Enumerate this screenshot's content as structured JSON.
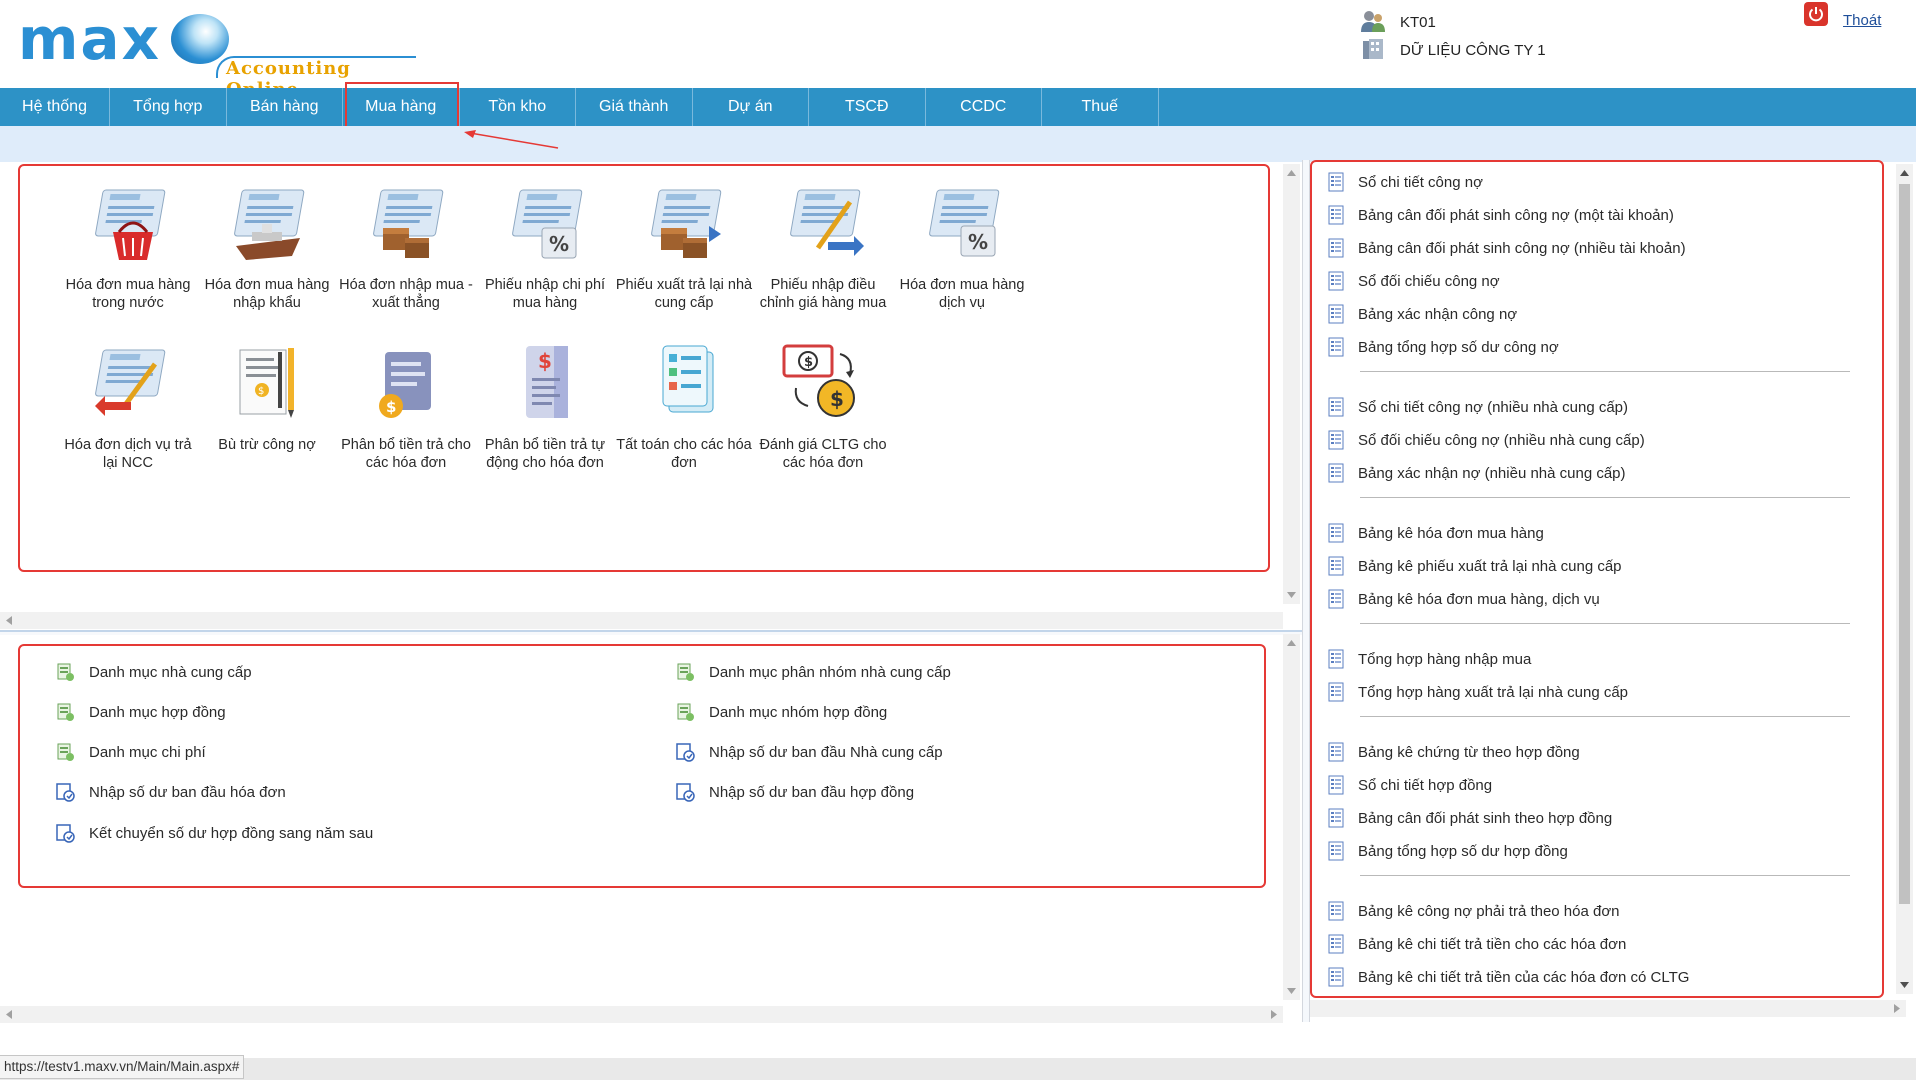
{
  "brand": {
    "logo_text": "maxv",
    "tagline": "Accounting Online"
  },
  "user": {
    "name": "KT01",
    "company": "DỮ LIỆU CÔNG TY 1",
    "logout_label": "Thoát"
  },
  "nav": {
    "items": [
      {
        "label": "Hệ thống"
      },
      {
        "label": "Tổng hợp"
      },
      {
        "label": "Bán hàng"
      },
      {
        "label": "Mua hàng"
      },
      {
        "label": "Tồn kho"
      },
      {
        "label": "Giá thành"
      },
      {
        "label": "Dự án"
      },
      {
        "label": "TSCĐ"
      },
      {
        "label": "CCDC"
      },
      {
        "label": "Thuế"
      }
    ],
    "active": "Mua hàng"
  },
  "tiles": [
    {
      "label": "Hóa đơn mua hàng trong nước",
      "icon": "invoice-basket-icon"
    },
    {
      "label": "Hóa đơn mua hàng nhập khẩu",
      "icon": "invoice-ship-icon"
    },
    {
      "label": "Hóa đơn nhập mua - xuất thẳng",
      "icon": "invoice-boxes-icon"
    },
    {
      "label": "Phiếu nhập chi phí mua hàng",
      "icon": "invoice-percent-icon"
    },
    {
      "label": "Phiếu xuất trả lại nhà cung cấp",
      "icon": "invoice-return-boxes-icon"
    },
    {
      "label": "Phiếu nhập điều chỉnh giá hàng mua",
      "icon": "invoice-adjust-icon"
    },
    {
      "label": "Hóa đơn mua hàng dịch vụ",
      "icon": "invoice-service-icon"
    },
    {
      "label": "Hóa đơn dịch vụ trả lại NCC",
      "icon": "invoice-return-icon"
    },
    {
      "label": "Bù trừ công nợ",
      "icon": "offset-debt-icon"
    },
    {
      "label": "Phân bổ tiền trả cho các hóa đơn",
      "icon": "allocate-payment-icon"
    },
    {
      "label": "Phân bổ tiền trả tự động cho hóa đơn",
      "icon": "auto-allocate-icon"
    },
    {
      "label": "Tất toán cho các hóa đơn",
      "icon": "settle-invoices-icon"
    },
    {
      "label": "Đánh giá CLTG cho các hóa đơn",
      "icon": "exchange-revaluation-icon"
    }
  ],
  "catalog_links": [
    {
      "label": "Danh mục nhà cung cấp",
      "icon": "catalog-icon"
    },
    {
      "label": "Danh mục phân nhóm nhà cung cấp",
      "icon": "catalog-icon"
    },
    {
      "label": "Danh mục hợp đồng",
      "icon": "catalog-icon"
    },
    {
      "label": "Danh mục nhóm hợp đồng",
      "icon": "catalog-icon"
    },
    {
      "label": "Danh mục chi phí",
      "icon": "catalog-icon"
    },
    {
      "label": "Nhập số dư ban đầu Nhà cung cấp",
      "icon": "opening-balance-icon"
    },
    {
      "label": "Nhập số dư ban đầu hóa đơn",
      "icon": "opening-balance-icon"
    },
    {
      "label": "Nhập số dư ban đầu hợp đồng",
      "icon": "opening-balance-icon"
    },
    {
      "label": "Kết chuyển số dư hợp đồng sang năm sau",
      "icon": "opening-balance-icon"
    }
  ],
  "report_groups": [
    [
      "Sổ chi tiết công nợ",
      "Bảng cân đối phát sinh công nợ (một tài khoản)",
      "Bảng cân đối phát sinh công nợ (nhiều tài khoản)",
      "Sổ đối chiếu công nợ",
      "Bảng xác nhận công nợ",
      "Bảng tổng hợp số dư công nợ"
    ],
    [
      "Sổ chi tiết công nợ (nhiều nhà cung cấp)",
      "Sổ đối chiếu công nợ (nhiều nhà cung cấp)",
      "Bảng xác nhận nợ (nhiều nhà cung cấp)"
    ],
    [
      "Bảng kê hóa đơn mua hàng",
      "Bảng kê phiếu xuất trả lại nhà cung cấp",
      "Bảng kê hóa đơn mua hàng, dịch vụ"
    ],
    [
      "Tổng hợp hàng nhập mua",
      "Tổng hợp hàng xuất trả lại nhà cung cấp"
    ],
    [
      "Bảng kê chứng từ theo hợp đồng",
      "Sổ chi tiết hợp đồng",
      "Bảng cân đối phát sinh theo hợp đồng",
      "Bảng tổng hợp số dư hợp đồng"
    ],
    [
      "Bảng kê công nợ phải trả theo hóa đơn",
      "Bảng kê chi tiết trả tiền cho các hóa đơn",
      "Bảng kê chi tiết trả tiền của các hóa đơn có CLTG"
    ]
  ],
  "status": {
    "url": "https://testv1.maxv.vn/Main/Main.aspx#"
  },
  "colors": {
    "nav_bg": "#2d92c6",
    "highlight": "#e53935",
    "subbar": "#dfecfa",
    "brand_blue": "#2b8fd3",
    "brand_gold": "#e8a200"
  }
}
